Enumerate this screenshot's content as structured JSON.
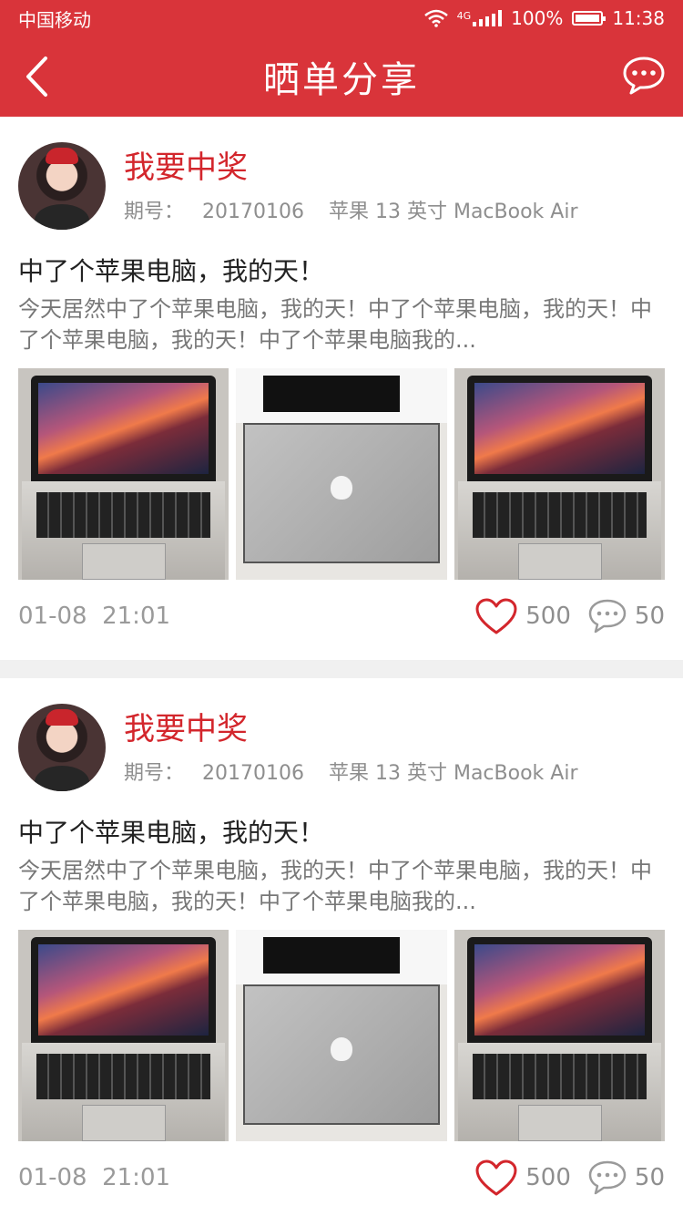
{
  "status_bar": {
    "carrier": "中国移动",
    "network": "4G",
    "battery": "100%",
    "time": "11:38"
  },
  "nav": {
    "title": "晒单分享"
  },
  "posts": [
    {
      "username": "我要中奖",
      "issue_label": "期号：",
      "issue_number": "20170106",
      "product": "苹果 13 英寸 MacBook Air",
      "title": "中了个苹果电脑，我的天！",
      "body": "今天居然中了个苹果电脑，我的天！中了个苹果电脑，我的天！中了个苹果电脑，我的天！中了个苹果电脑我的...",
      "date": "01-08",
      "time": "21:01",
      "likes": "500",
      "comments": "50"
    },
    {
      "username": "我要中奖",
      "issue_label": "期号：",
      "issue_number": "20170106",
      "product": "苹果 13 英寸 MacBook Air",
      "title": "中了个苹果电脑，我的天！",
      "body": "今天居然中了个苹果电脑，我的天！中了个苹果电脑，我的天！中了个苹果电脑，我的天！中了个苹果电脑我的...",
      "date": "01-08",
      "time": "21:01",
      "likes": "500",
      "comments": "50"
    }
  ],
  "colors": {
    "brand": "#d9343a",
    "username": "#d3262c"
  },
  "icons": [
    "back-arrow-icon",
    "message-icon",
    "wifi-icon",
    "signal-icon",
    "battery-icon",
    "heart-icon",
    "comment-icon"
  ]
}
